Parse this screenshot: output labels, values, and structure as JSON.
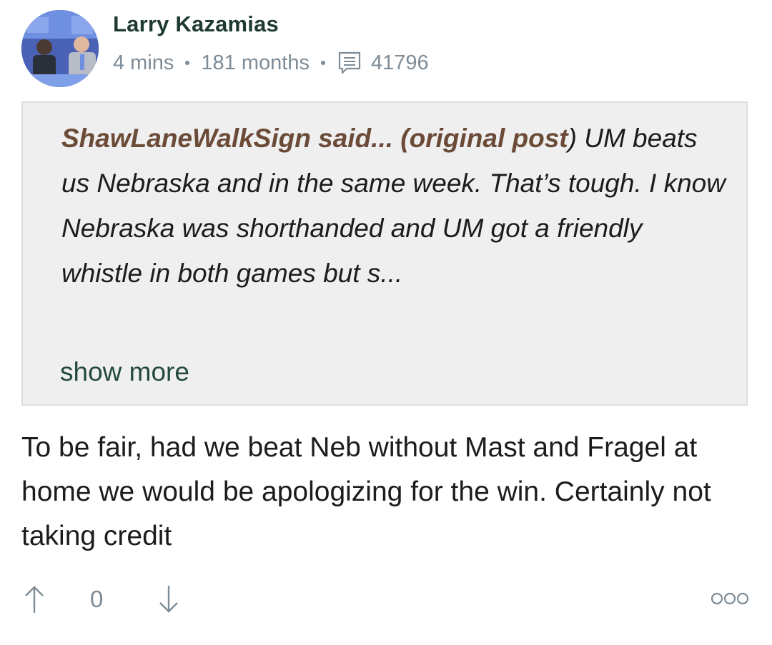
{
  "comment": {
    "author": "Larry Kazamias",
    "posted_ago": "4 mins",
    "member_for": "181 months",
    "post_count": "41796",
    "icons": {
      "avatar": "user-avatar-photo",
      "post_count": "comment-icon"
    },
    "quote": {
      "author_label": "ShawLaneWalkSign said... (original post",
      "closing_paren": ")",
      "text": " UM beats us Nebraska and in the same week. That’s tough. I know Nebraska was shorthanded and UM got a friendly whistle in both games but s...",
      "show_more_label": "show more"
    },
    "body": "To be fair, had we beat Neb without Mast and Fragel at home we would be apologizing for the win. Certainly not taking credit",
    "actions": {
      "upvote_icon": "arrow-up-icon",
      "vote_count": "0",
      "downvote_icon": "arrow-down-icon",
      "more_icon": "more-options-icon"
    }
  },
  "colors": {
    "author": "#1f3a33",
    "meta": "#7d8c97",
    "quote_author": "#6b4b38",
    "quote_background": "#efefef",
    "show_more": "#234a3d",
    "text": "#1c1c1c"
  }
}
